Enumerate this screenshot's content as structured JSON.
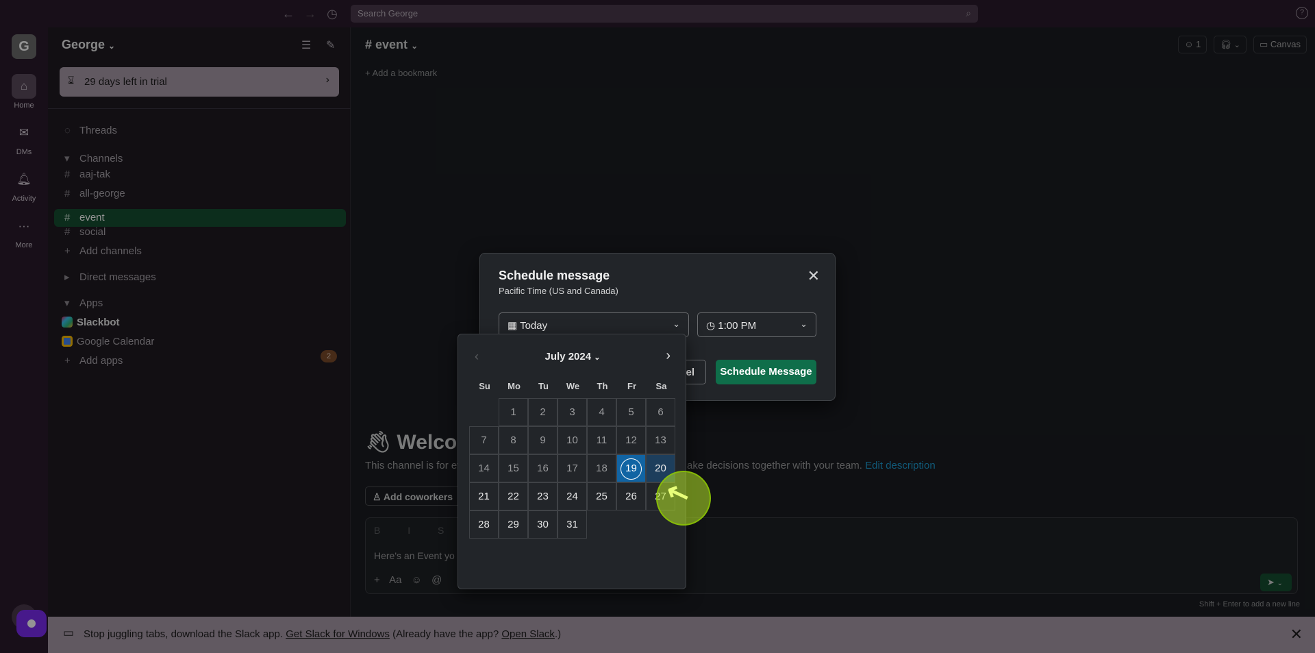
{
  "topbar": {
    "search_placeholder": "Search George",
    "help": "?"
  },
  "rail": {
    "workspace_initial": "G",
    "items": [
      {
        "label": "Home"
      },
      {
        "label": "DMs"
      },
      {
        "label": "Activity"
      },
      {
        "label": "More"
      }
    ]
  },
  "sidebar": {
    "workspace_name": "George",
    "trial": "29 days left in trial",
    "threads": "Threads",
    "channels_header": "Channels",
    "channels": [
      "aaj-tak",
      "all-george",
      "event",
      "social"
    ],
    "add_channels": "Add channels",
    "direct_messages": "Direct messages",
    "apps_header": "Apps",
    "apps": [
      {
        "name": "Slackbot",
        "badge": "2"
      },
      {
        "name": "Google Calendar"
      }
    ],
    "add_apps": "Add apps"
  },
  "main": {
    "channel": "event",
    "add_bookmark": "Add a bookmark",
    "huddle_count": "1",
    "canvas": "Canvas",
    "welcome": "Welcom",
    "desc_start": "This channel is for ev",
    "desc_end": "ake decisions together with your team.",
    "edit_description": "Edit description",
    "add_coworkers": "Add coworkers",
    "format_bar": "B I S",
    "draft": "Here's an Event yo",
    "composer_tools": "+ Aa ☺ @",
    "hint": "Shift + Enter to add a new line"
  },
  "modal": {
    "title": "Schedule message",
    "timezone": "Pacific Time (US and Canada)",
    "date_value": "Today",
    "time_value": "1:00 PM",
    "cancel_partial": "cel",
    "schedule_button": "Schedule Message"
  },
  "calendar": {
    "month": "July 2024",
    "weekdays": [
      "Su",
      "Mo",
      "Tu",
      "We",
      "Th",
      "Fr",
      "Sa"
    ],
    "first_weekday_index": 1,
    "days_in_month": 31,
    "selected_day": 19,
    "hover_day": 20,
    "today": 19
  },
  "banner": {
    "text_before": "Stop juggling tabs, download the Slack app.",
    "link1": "Get Slack for Windows",
    "text_mid": "(Already have the app?",
    "link2": "Open Slack",
    "text_end": ".)"
  },
  "colors": {
    "accent_green": "#0f6e4a",
    "selected_blue": "#1164a3",
    "link_blue": "#1d9bd1",
    "aubergine": "#2a1a2b"
  }
}
